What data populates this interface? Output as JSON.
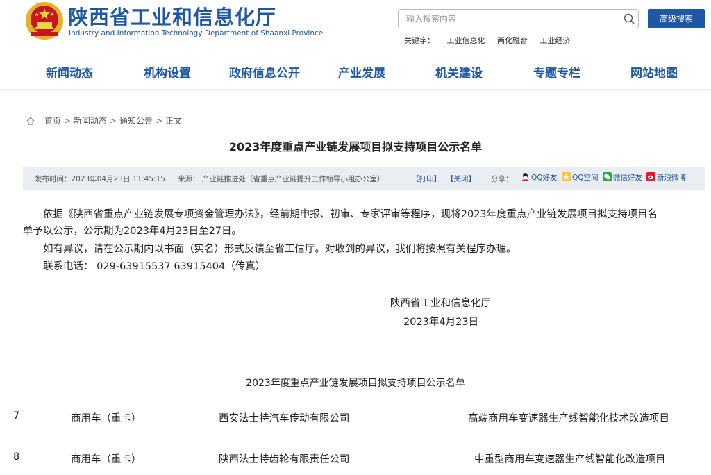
{
  "header": {
    "title": "陕西省工业和信息化厅",
    "subtitle": "Industry and Information Technology Department of Shaanxi Province",
    "search_placeholder": "输入搜索内容",
    "advanced_search": "高级搜索",
    "keywords_label": "关键字：",
    "keywords": [
      "工业信息化",
      "两化融合",
      "工业经济"
    ]
  },
  "nav": [
    "新闻动态",
    "机构设置",
    "政府信息公开",
    "产业发展",
    "机关建设",
    "专题专栏",
    "网站地图"
  ],
  "breadcrumb": [
    "首页",
    "新闻动态",
    "通知公告",
    "正文"
  ],
  "article": {
    "title": "2023年度重点产业链发展项目拟支持项目公示名单",
    "meta": {
      "publish_time": "发布时间：2023年04月23日 11:45:15",
      "source": "来源：  产业链推进处（省重点产业链提升工作领导小组办公室）",
      "print": "【打印】",
      "close": "【关闭】",
      "share_label": "分享：",
      "share": [
        "QQ好友",
        "QQ空间",
        "微信好友",
        "新浪微博"
      ]
    },
    "paragraphs": [
      "依据《陕西省重点产业链发展专项资金管理办法》，经前期申报、初审、专家评审等程序，现将2023年度重点产业链发展项目拟支持项目名",
      "单予以公示，公示期为2023年4月23日至27日。",
      "如有异议，请在公示期内以书面（实名）形式反馈至省工信厅。对收到的异议，我们将按照有关程序办理。",
      "联系电话：  029-63915537    63915404（传真）"
    ],
    "signature": {
      "org": "陕西省工业和信息化厅",
      "date": "2023年4月23日"
    },
    "table_title": "2023年度重点产业链发展项目拟支持项目公示名单",
    "rows": [
      {
        "no": "7",
        "chain": "商用车（重卡）",
        "company": "西安法士特汽车传动有限公司",
        "project": "高端商用车变速器生产线智能化技术改造项目"
      },
      {
        "no": "8",
        "chain": "商用车（重卡）",
        "company": "陕西法士特齿轮有限责任公司",
        "project": "中重型商用车变速器生产线智能化改造项目"
      }
    ]
  }
}
